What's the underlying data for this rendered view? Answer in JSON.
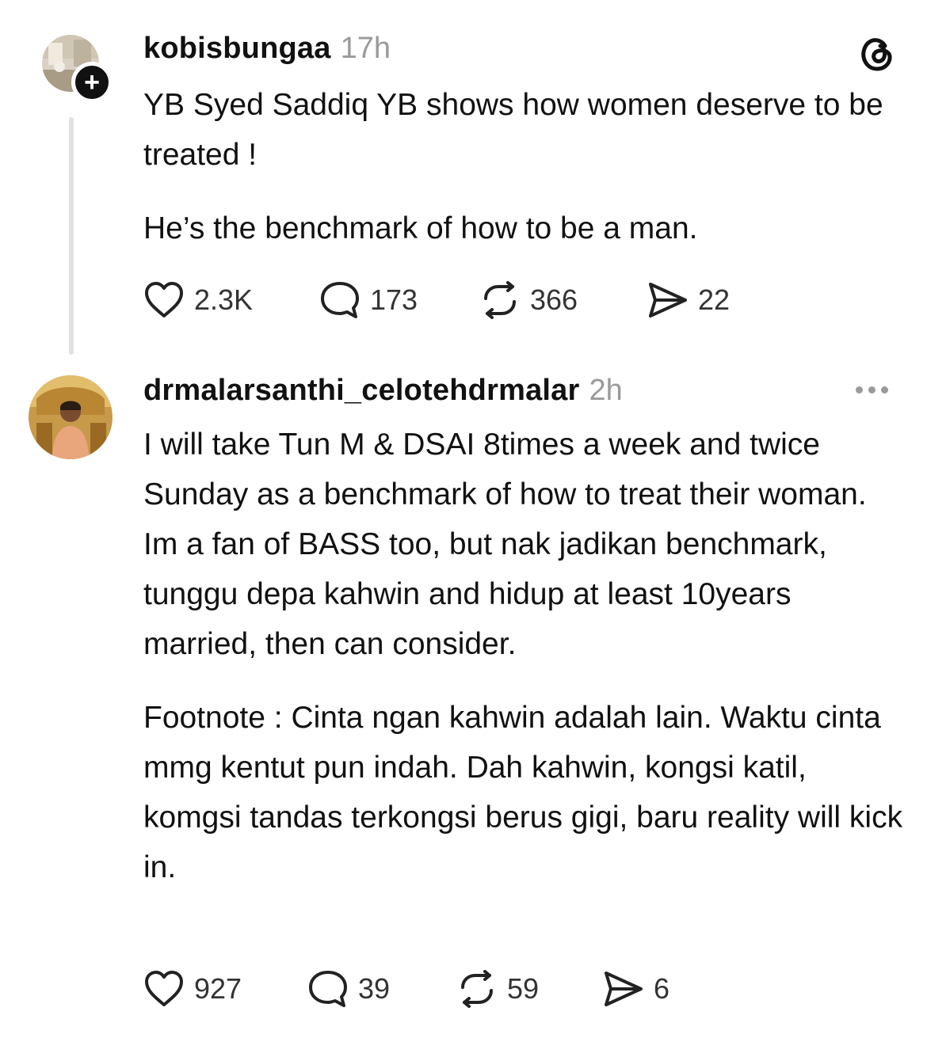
{
  "post1": {
    "username": "kobisbungaa",
    "time": "17h",
    "paragraphs": [
      "YB Syed Saddiq YB shows how women deserve to be treated !",
      "He’s the benchmark of how to be a man."
    ],
    "follow_badge": "+",
    "actions": {
      "likes": "2.3K",
      "replies": "173",
      "reposts": "366",
      "shares": "22"
    }
  },
  "post2": {
    "username": "drmalarsanthi_celotehdrmalar",
    "time": "2h",
    "paragraphs": [
      "I will take Tun M & DSAI 8times a week and twice Sunday as a benchmark of how to treat their woman. Im a fan of BASS too, but nak jadikan benchmark, tunggu depa kahwin and hidup at least 10years married, then can consider.",
      "Footnote : Cinta ngan kahwin adalah lain. Waktu cinta mmg kentut pun indah. Dah kahwin, kongsi katil, komgsi tandas terkongsi berus gigi, baru reality will kick in."
    ],
    "actions": {
      "likes": "927",
      "replies": "39",
      "reposts": "59",
      "shares": "6"
    }
  },
  "icons": {
    "like": "heart-icon",
    "reply": "speech-bubble-icon",
    "repost": "repost-arrows-icon",
    "share": "send-arrow-icon",
    "logo": "threads-logo-icon",
    "more": "more-dots-icon"
  }
}
